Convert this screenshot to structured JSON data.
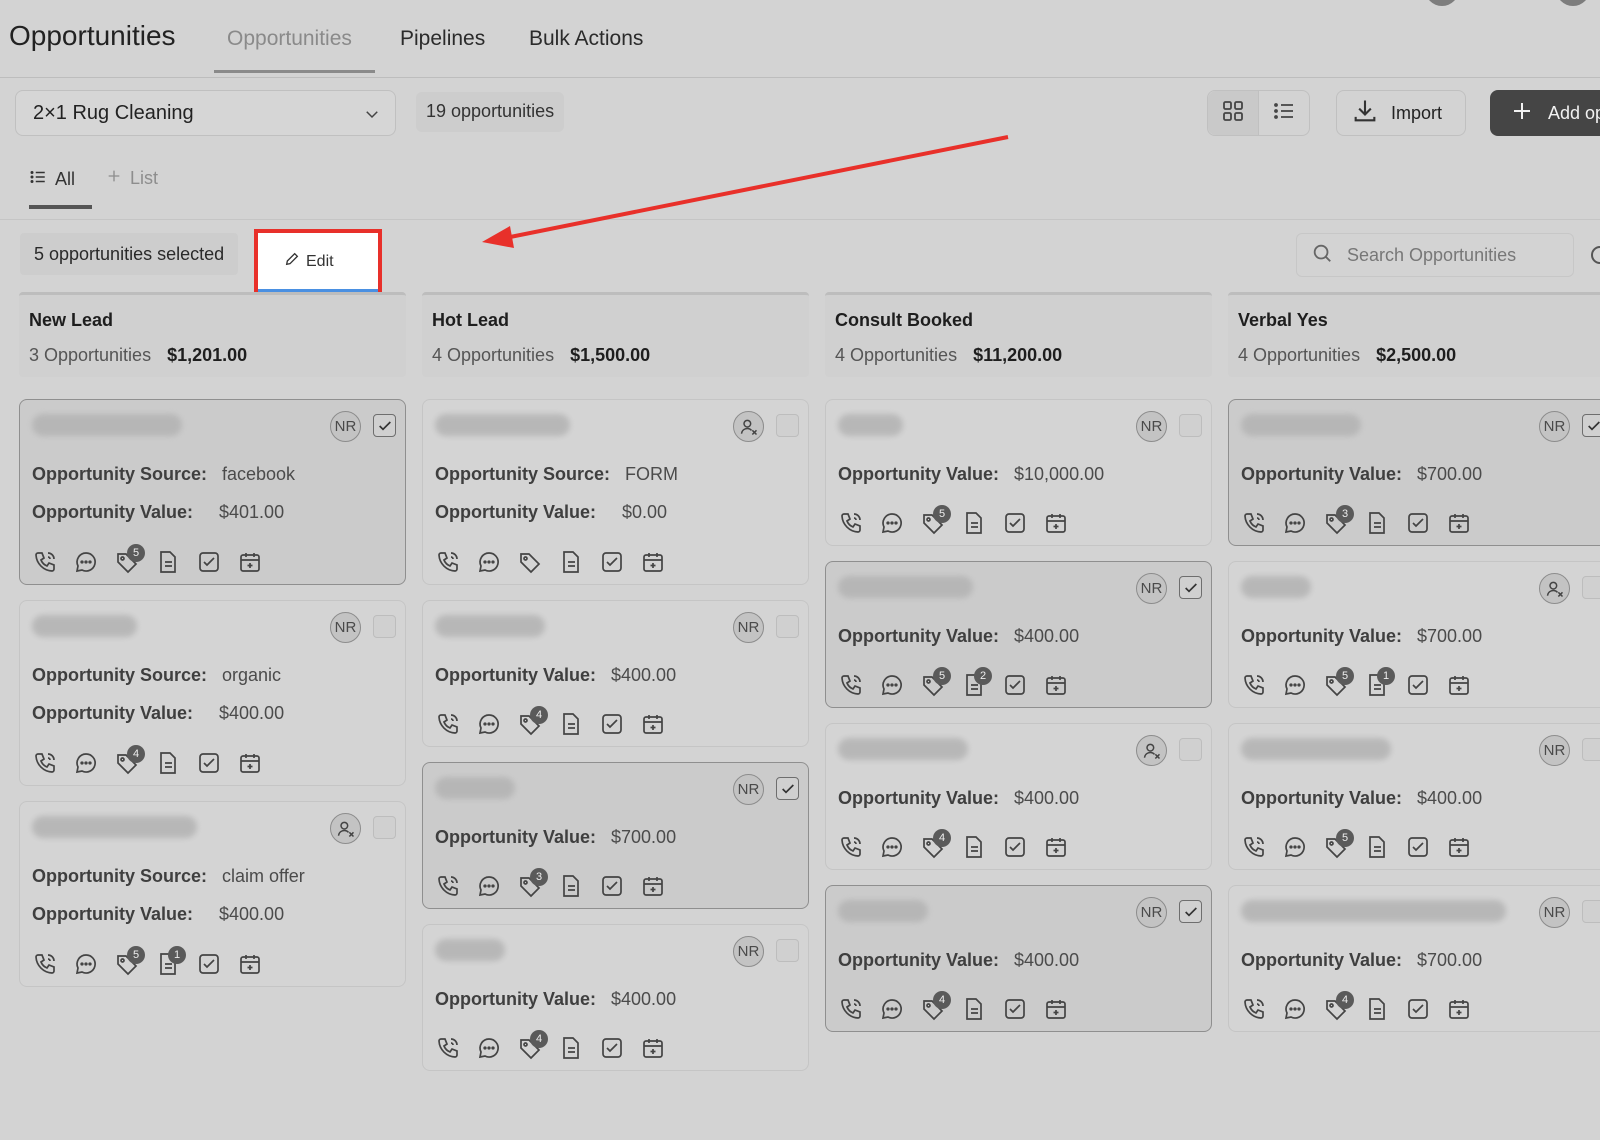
{
  "header": {
    "title": "Opportunities",
    "tabs": [
      {
        "label": "Opportunities",
        "active": true
      },
      {
        "label": "Pipelines",
        "active": false
      },
      {
        "label": "Bulk Actions",
        "active": false
      }
    ]
  },
  "toolbar": {
    "pipeline": "2×1 Rug Cleaning",
    "count": "19 opportunities",
    "import_label": "Import",
    "add_label": "Add op"
  },
  "subtabs": {
    "all": "All",
    "list": "List"
  },
  "selection": {
    "text": "5 opportunities selected",
    "edit_label": "Edit"
  },
  "search": {
    "placeholder": "Search Opportunities"
  },
  "colors": {
    "annotation_red": "#e8302a",
    "underline_blue": "#4a90e2"
  },
  "labels": {
    "source": "Opportunity Source:",
    "value": "Opportunity Value:",
    "owner": "NR"
  },
  "columns": [
    {
      "name": "New Lead",
      "count": "3 Opportunities",
      "total": "$1,201.00",
      "cards": [
        {
          "selected": true,
          "owner": "avatar",
          "source": "facebook",
          "value": "$401.00",
          "icons": [
            null,
            null,
            "5",
            null,
            null,
            null
          ]
        },
        {
          "selected": false,
          "owner": "avatar",
          "source": "organic",
          "value": "$400.00",
          "icons": [
            null,
            null,
            "4",
            null,
            null,
            null
          ]
        },
        {
          "selected": false,
          "owner": "unassigned",
          "source": "claim offer",
          "value": "$400.00",
          "icons": [
            null,
            null,
            "5",
            "1",
            null,
            null
          ]
        }
      ]
    },
    {
      "name": "Hot Lead",
      "count": "4 Opportunities",
      "total": "$1,500.00",
      "cards": [
        {
          "selected": false,
          "owner": "unassigned",
          "source": "FORM",
          "value": "$0.00",
          "icons": [
            null,
            null,
            "",
            null,
            null,
            null
          ]
        },
        {
          "selected": false,
          "owner": "avatar",
          "source": null,
          "value": "$400.00",
          "icons": [
            null,
            null,
            "4",
            null,
            null,
            null
          ]
        },
        {
          "selected": true,
          "owner": "avatar",
          "source": null,
          "value": "$700.00",
          "icons": [
            null,
            null,
            "3",
            null,
            null,
            null
          ]
        },
        {
          "selected": false,
          "owner": "avatar",
          "source": null,
          "value": "$400.00",
          "icons": [
            null,
            null,
            "4",
            null,
            null,
            null
          ]
        }
      ]
    },
    {
      "name": "Consult Booked",
      "count": "4 Opportunities",
      "total": "$11,200.00",
      "cards": [
        {
          "selected": false,
          "owner": "avatar",
          "source": null,
          "value": "$10,000.00",
          "icons": [
            null,
            null,
            "5",
            null,
            null,
            null
          ]
        },
        {
          "selected": true,
          "owner": "avatar",
          "source": null,
          "value": "$400.00",
          "icons": [
            null,
            null,
            "5",
            "2",
            null,
            null
          ]
        },
        {
          "selected": false,
          "owner": "unassigned",
          "source": null,
          "value": "$400.00",
          "icons": [
            null,
            null,
            "4",
            null,
            null,
            null
          ]
        },
        {
          "selected": true,
          "owner": "avatar",
          "source": null,
          "value": "$400.00",
          "icons": [
            null,
            null,
            "4",
            null,
            null,
            null
          ]
        }
      ]
    },
    {
      "name": "Verbal Yes",
      "count": "4 Opportunities",
      "total": "$2,500.00",
      "cards": [
        {
          "selected": true,
          "owner": "avatar",
          "source": null,
          "value": "$700.00",
          "icons": [
            null,
            null,
            "3",
            null,
            null,
            null
          ]
        },
        {
          "selected": false,
          "owner": "unassigned",
          "source": null,
          "value": "$700.00",
          "icons": [
            null,
            null,
            "5",
            "1",
            null,
            null
          ]
        },
        {
          "selected": false,
          "owner": "avatar",
          "source": null,
          "value": "$400.00",
          "icons": [
            null,
            null,
            "5",
            null,
            null,
            null
          ]
        },
        {
          "selected": false,
          "owner": "avatar",
          "source": null,
          "value": "$700.00",
          "icons": [
            null,
            null,
            "4",
            null,
            null,
            null
          ]
        }
      ]
    }
  ]
}
